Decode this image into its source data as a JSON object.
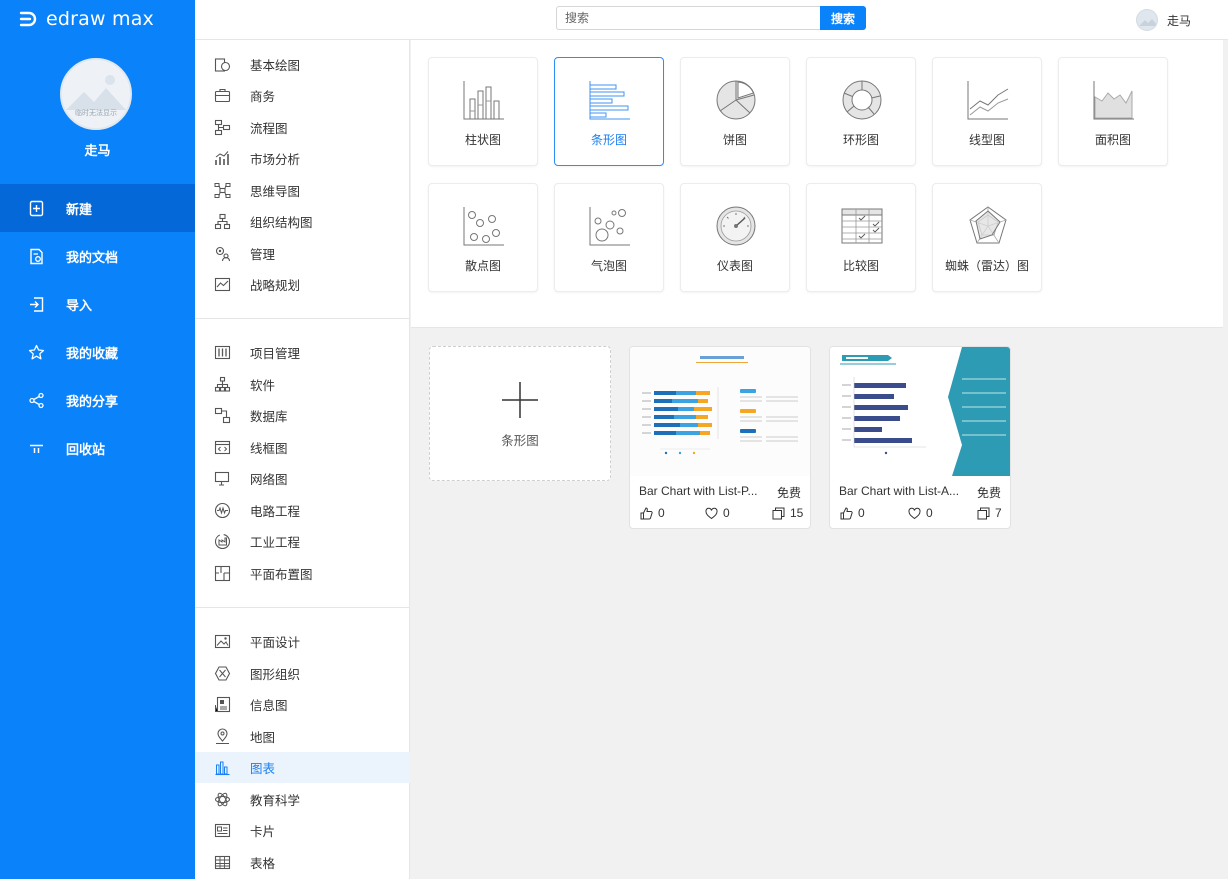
{
  "app": {
    "logo_text": "edraw max"
  },
  "user": {
    "name": "走马",
    "avatar_caption": "临时无法显示"
  },
  "search": {
    "placeholder": "搜索",
    "button_label": "搜索"
  },
  "nav": [
    {
      "label": "新建",
      "icon": "new-doc-icon",
      "active": true
    },
    {
      "label": "我的文档",
      "icon": "document-icon",
      "active": false
    },
    {
      "label": "导入",
      "icon": "import-icon",
      "active": false
    },
    {
      "label": "我的收藏",
      "icon": "star-icon",
      "active": false
    },
    {
      "label": "我的分享",
      "icon": "share-icon",
      "active": false
    },
    {
      "label": "回收站",
      "icon": "trash-icon",
      "active": false
    }
  ],
  "categories": {
    "group1": [
      "基本绘图",
      "商务",
      "流程图",
      "市场分析",
      "思维导图",
      "组织结构图",
      "管理",
      "战略规划"
    ],
    "group2": [
      "项目管理",
      "软件",
      "数据库",
      "线框图",
      "网络图",
      "电路工程",
      "工业工程",
      "平面布置图"
    ],
    "group3": [
      "平面设计",
      "图形组织",
      "信息图",
      "地图",
      "图表",
      "教育科学",
      "卡片",
      "表格"
    ],
    "active": "图表"
  },
  "chart_types": [
    {
      "label": "柱状图",
      "icon": "column-chart-icon"
    },
    {
      "label": "条形图",
      "icon": "bar-chart-icon",
      "active": true
    },
    {
      "label": "饼图",
      "icon": "pie-chart-icon"
    },
    {
      "label": "环形图",
      "icon": "donut-chart-icon"
    },
    {
      "label": "线型图",
      "icon": "line-chart-icon"
    },
    {
      "label": "面积图",
      "icon": "area-chart-icon"
    },
    {
      "label": "散点图",
      "icon": "scatter-chart-icon"
    },
    {
      "label": "气泡图",
      "icon": "bubble-chart-icon"
    },
    {
      "label": "仪表图",
      "icon": "gauge-chart-icon"
    },
    {
      "label": "比较图",
      "icon": "comparison-chart-icon"
    },
    {
      "label": "蜘蛛（雷达）图",
      "icon": "radar-chart-icon"
    }
  ],
  "new_blank": {
    "label": "条形图",
    "icon": "plus-icon"
  },
  "templates": [
    {
      "title": "Bar Chart with List-P...",
      "price": "免费",
      "likes": "0",
      "favorites": "0",
      "copies": "15"
    },
    {
      "title": "Bar Chart with List-A...",
      "price": "免费",
      "likes": "0",
      "favorites": "0",
      "copies": "7"
    }
  ],
  "colors": {
    "primary": "#0a82fa",
    "active_nav": "#0568d8",
    "accent_text": "#1a7ff0"
  }
}
